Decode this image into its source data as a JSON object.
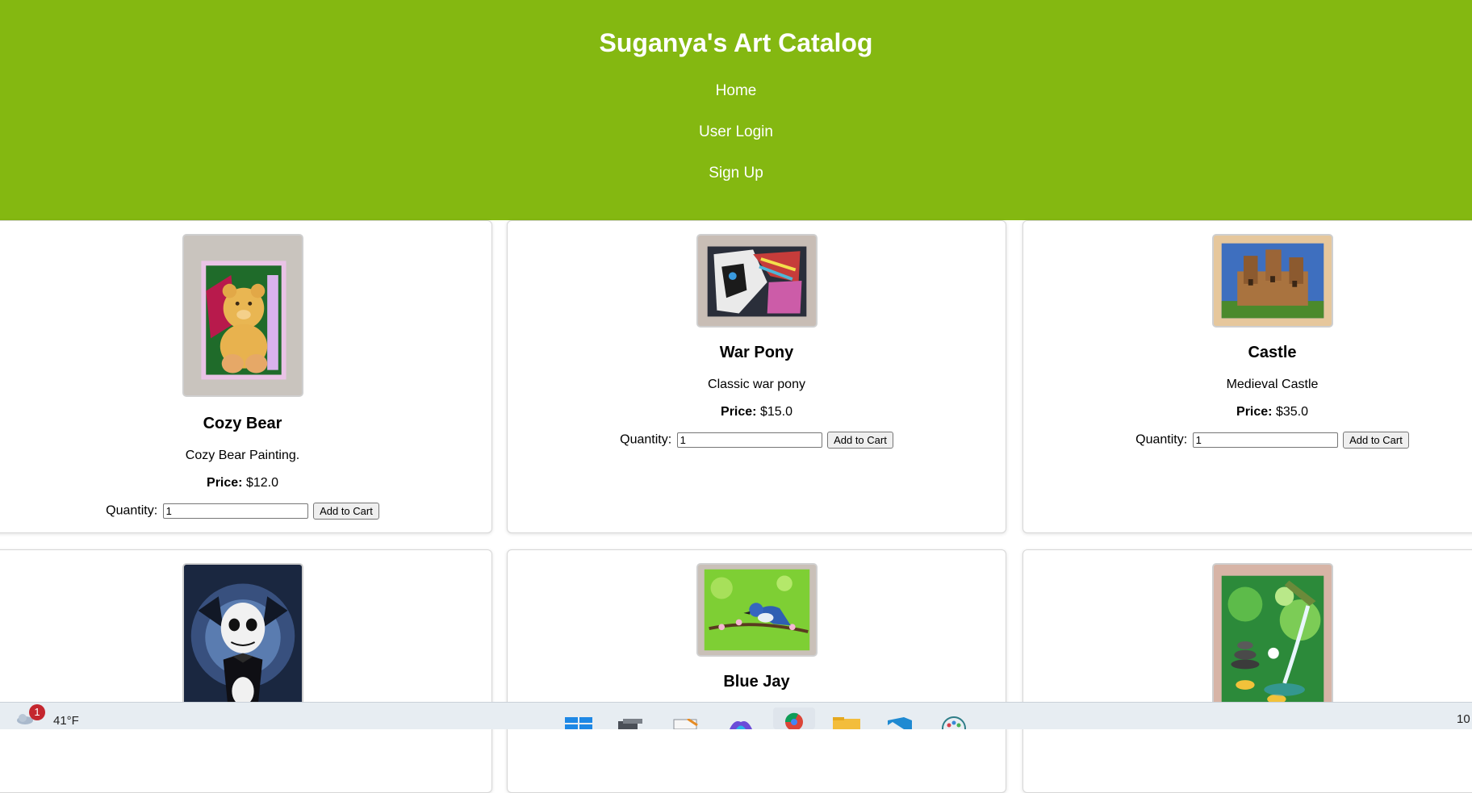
{
  "header": {
    "title": "Suganya's Art Catalog",
    "nav": [
      "Home",
      "User Login",
      "Sign Up"
    ]
  },
  "products": [
    {
      "title": "Cozy Bear",
      "description": "Cozy Bear Painting.",
      "price_label": "Price:",
      "price": "$12.0",
      "quantity_label": "Quantity:",
      "quantity": "1",
      "button": "Add to Cart"
    },
    {
      "title": "War Pony",
      "description": "Classic war pony",
      "price_label": "Price:",
      "price": "$15.0",
      "quantity_label": "Quantity:",
      "quantity": "1",
      "button": "Add to Cart"
    },
    {
      "title": "Castle",
      "description": "Medieval Castle",
      "price_label": "Price:",
      "price": "$35.0",
      "quantity_label": "Quantity:",
      "quantity": "1",
      "button": "Add to Cart"
    },
    {
      "title": ""
    },
    {
      "title": "Blue Jay"
    },
    {
      "title": ""
    }
  ],
  "taskbar": {
    "weather_badge": "1",
    "temperature": "41°F",
    "clock": "10"
  },
  "colors": {
    "header_bg": "#84b811"
  }
}
